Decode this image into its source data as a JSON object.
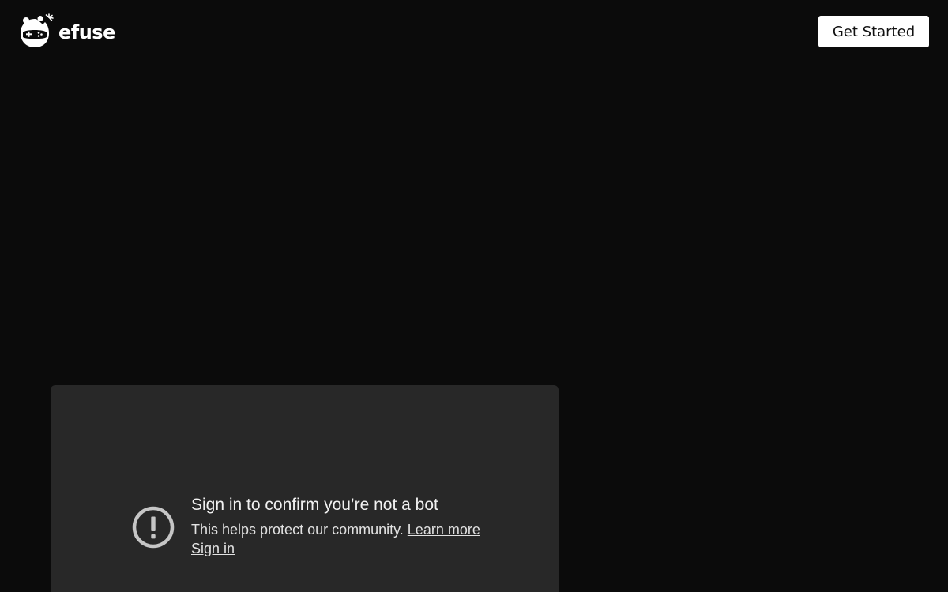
{
  "header": {
    "brand": "efuse",
    "logo_icon": "efuse-gamer-mascot-icon",
    "cta_label": "Get Started"
  },
  "video_notice": {
    "icon": "alert-circle-icon",
    "title": "Sign in to confirm you’re not a bot",
    "message": "This helps protect our community.",
    "learn_more": "Learn more",
    "sign_in": "Sign in"
  },
  "colors": {
    "background": "#0b0b0b",
    "player_background": "#282828",
    "cta_background": "#ffffff",
    "text_primary": "#f1f1f1",
    "icon": "#c6c6c6"
  }
}
